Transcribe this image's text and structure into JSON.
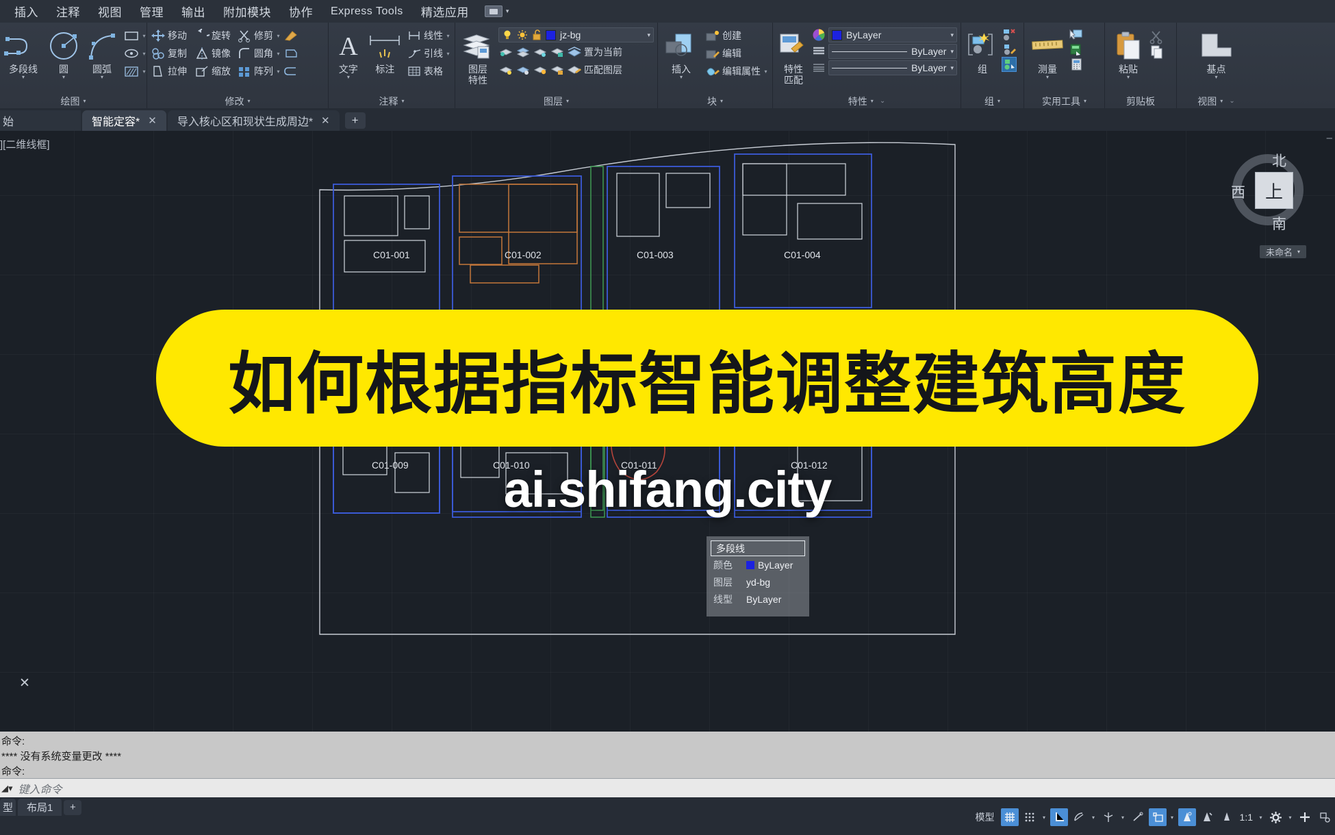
{
  "menubar": {
    "items": [
      {
        "label": "插入",
        "latin": false
      },
      {
        "label": "注释",
        "latin": false
      },
      {
        "label": "视图",
        "latin": false
      },
      {
        "label": "管理",
        "latin": false
      },
      {
        "label": "输出",
        "latin": false
      },
      {
        "label": "附加模块",
        "latin": false
      },
      {
        "label": "协作",
        "latin": false
      },
      {
        "label": "Express Tools",
        "latin": true
      },
      {
        "label": "精选应用",
        "latin": false
      }
    ],
    "caret": "▾"
  },
  "ribbon": {
    "panels": {
      "draw": {
        "title": "绘图",
        "big": [
          {
            "label": "多段线",
            "icon": "polyline-icon",
            "caret": "▾"
          },
          {
            "label": "圆",
            "icon": "circle-icon",
            "caret": "▾"
          },
          {
            "label": "圆弧",
            "icon": "arc-icon",
            "caret": "▾"
          }
        ],
        "small": [
          {
            "icon": "rectangle-icon",
            "caret": "▾"
          },
          {
            "icon": "ellipse-icon",
            "caret": "▾"
          },
          {
            "icon": "hatch-icon",
            "caret": "▾"
          }
        ]
      },
      "modify": {
        "title": "修改",
        "rows": [
          [
            {
              "label": "移动",
              "icon": "move-icon"
            },
            {
              "label": "旋转",
              "icon": "rotate-icon"
            },
            {
              "label": "修剪",
              "icon": "trim-icon",
              "caret": "▾"
            },
            {
              "icon": "erase-icon"
            }
          ],
          [
            {
              "label": "复制",
              "icon": "copy-icon"
            },
            {
              "label": "镜像",
              "icon": "mirror-icon"
            },
            {
              "label": "圆角",
              "icon": "fillet-icon",
              "caret": "▾"
            },
            {
              "icon": "explode-icon"
            }
          ],
          [
            {
              "label": "拉伸",
              "icon": "stretch-icon"
            },
            {
              "label": "缩放",
              "icon": "scale-icon"
            },
            {
              "label": "阵列",
              "icon": "array-icon",
              "caret": "▾"
            },
            {
              "icon": "join-icon"
            }
          ]
        ]
      },
      "annotation": {
        "title": "注释",
        "big": [
          {
            "label": "文字",
            "icon": "text-icon",
            "caret": "▾"
          },
          {
            "label": "标注",
            "icon": "dimension-icon",
            "caret": ""
          }
        ],
        "small": [
          {
            "label": "线性",
            "icon": "linear-dim-icon",
            "caret": "▾"
          },
          {
            "label": "引线",
            "icon": "leader-icon",
            "caret": "▾"
          },
          {
            "label": "表格",
            "icon": "table-icon",
            "caret": ""
          }
        ]
      },
      "layers": {
        "title": "图层",
        "big": {
          "label_line1": "图层",
          "label_line2": "特性",
          "icon": "layer-properties-icon"
        },
        "current_layer": "jz-bg",
        "layer_color": "#1c22e0",
        "row1_buttons": [
          {
            "icon": "layer-isolate-icon"
          },
          {
            "icon": "layer-unisolate-icon"
          },
          {
            "icon": "layer-freeze-icon"
          },
          {
            "icon": "layer-lock-icon"
          }
        ],
        "row1_label": "置为当前",
        "row1_label_icon": "layer-make-current-icon",
        "row2_buttons": [
          {
            "icon": "layer-on-icon"
          },
          {
            "icon": "layer-off-icon"
          },
          {
            "icon": "layer-thaw-icon"
          },
          {
            "icon": "layer-unlock-icon"
          }
        ],
        "row2_label": "匹配图层",
        "row2_label_icon": "layer-match-icon",
        "dropdown_caret": "▾"
      },
      "block": {
        "title": "块",
        "big": {
          "label": "插入",
          "icon": "insert-block-icon",
          "caret": "▾"
        },
        "small": [
          {
            "label": "创建",
            "icon": "create-block-icon"
          },
          {
            "label": "编辑",
            "icon": "edit-block-icon"
          },
          {
            "label": "编辑属性",
            "icon": "edit-attributes-icon",
            "caret": "▾"
          }
        ]
      },
      "properties": {
        "title": "特性",
        "big": {
          "label_line1": "特性",
          "label_line2": "匹配",
          "icon": "match-properties-icon"
        },
        "combos": [
          {
            "type": "color",
            "value": "ByLayer",
            "swatch": "#1c22e0",
            "icon": "color-wheel-icon",
            "caret": "▾"
          },
          {
            "type": "linetype",
            "value": "ByLayer",
            "icon": "linetype-icon",
            "caret": "▾"
          },
          {
            "type": "lineweight",
            "value": "ByLayer",
            "icon": "lineweight-icon",
            "caret": "▾"
          }
        ],
        "diag": "⌄"
      },
      "groups": {
        "title": "组",
        "big": {
          "label": "组",
          "icon": "group-icon"
        },
        "small": [
          {
            "icon": "ungroup-icon"
          },
          {
            "icon": "group-edit-icon"
          },
          {
            "icon": "group-selection-on-icon",
            "active": true
          }
        ]
      },
      "utilities": {
        "title": "实用工具",
        "big": {
          "label": "测量",
          "icon": "measure-icon",
          "caret": "▾"
        },
        "small": [
          {
            "icon": "quick-select-icon"
          },
          {
            "icon": "quick-calc-green-icon"
          },
          {
            "icon": "calculator-icon"
          }
        ]
      },
      "clipboard": {
        "title": "剪贴板",
        "big": {
          "label": "粘贴",
          "icon": "paste-icon",
          "caret": "▾"
        },
        "small": [
          {
            "icon": "cut-icon"
          },
          {
            "icon": "copy-clip-icon"
          }
        ]
      },
      "view": {
        "title": "视图",
        "big": {
          "label": "基点",
          "icon": "base-point-icon",
          "caret": "▾"
        },
        "caret": "▾",
        "diag": "⌄"
      }
    }
  },
  "filetabs": {
    "tabs": [
      {
        "label": "始",
        "active": false,
        "clipped": true,
        "close": ""
      },
      {
        "label": "智能定容*",
        "active": true,
        "clipped": false,
        "close": "✕"
      },
      {
        "label": "导入核心区和现状生成周边*",
        "active": false,
        "clipped": false,
        "close": "✕"
      }
    ],
    "add_label": "+"
  },
  "canvas": {
    "viewport_label": "][二维线框]",
    "minimize": "–",
    "viewcube": {
      "north": "北",
      "south": "南",
      "west": "西",
      "top": "上",
      "named_view": "未命名",
      "named_caret": "▾"
    },
    "plots": [
      {
        "id": "C01-001"
      },
      {
        "id": "C01-002"
      },
      {
        "id": "C01-003"
      },
      {
        "id": "C01-004"
      },
      {
        "id": "C01-009"
      },
      {
        "id": "C01-010"
      },
      {
        "id": "C01-011"
      },
      {
        "id": "C01-012"
      }
    ],
    "quick_properties": {
      "header": "多段线",
      "rows": [
        {
          "key": "颜色",
          "value": "ByLayer",
          "swatch": "#1c22e0"
        },
        {
          "key": "图层",
          "value": "yd-bg",
          "swatch": ""
        },
        {
          "key": "线型",
          "value": "ByLayer",
          "swatch": ""
        }
      ]
    },
    "close_marker": "✕"
  },
  "overlay": {
    "title": "如何根据指标智能调整建筑高度",
    "subtitle": "ai.shifang.city",
    "pill_color": "#ffe800"
  },
  "command": {
    "history": [
      "命令:",
      "**** 没有系统变量更改 ****",
      "命令:"
    ],
    "prompt_arrow": "◢▾",
    "placeholder": "键入命令"
  },
  "bottom": {
    "layout_tabs": [
      {
        "label": "型",
        "first": true
      },
      {
        "label": "布局1",
        "first": false
      }
    ],
    "add_layout": "+",
    "status": {
      "model_label": "模型",
      "scale": "1:1",
      "scale_caret": "▾",
      "buttons": [
        {
          "icon": "grid-display-icon",
          "on": true,
          "caret": ""
        },
        {
          "icon": "snap-mode-icon",
          "on": false,
          "caret": "▾"
        },
        {
          "icon": "ortho-mode-icon",
          "on": true,
          "caret": ""
        },
        {
          "icon": "polar-tracking-icon",
          "on": false,
          "caret": "▾"
        },
        {
          "icon": "isometric-draft-icon",
          "on": false,
          "caret": "▾"
        },
        {
          "icon": "object-snap-tracking-icon",
          "on": false,
          "caret": ""
        },
        {
          "icon": "object-snap-icon",
          "on": true,
          "caret": "▾"
        },
        {
          "icon": "lineweight-show-icon",
          "on": true,
          "caret": ""
        },
        {
          "icon": "transparency-icon",
          "on": false,
          "caret": ""
        },
        {
          "icon": "selection-cycling-icon",
          "on": false,
          "caret": ""
        }
      ],
      "gear_icon": "customization-gear-icon",
      "gear_caret": "▾",
      "plus_icon": "add-tool-icon",
      "annotation_icon": "annotation-visibility-icon"
    }
  }
}
